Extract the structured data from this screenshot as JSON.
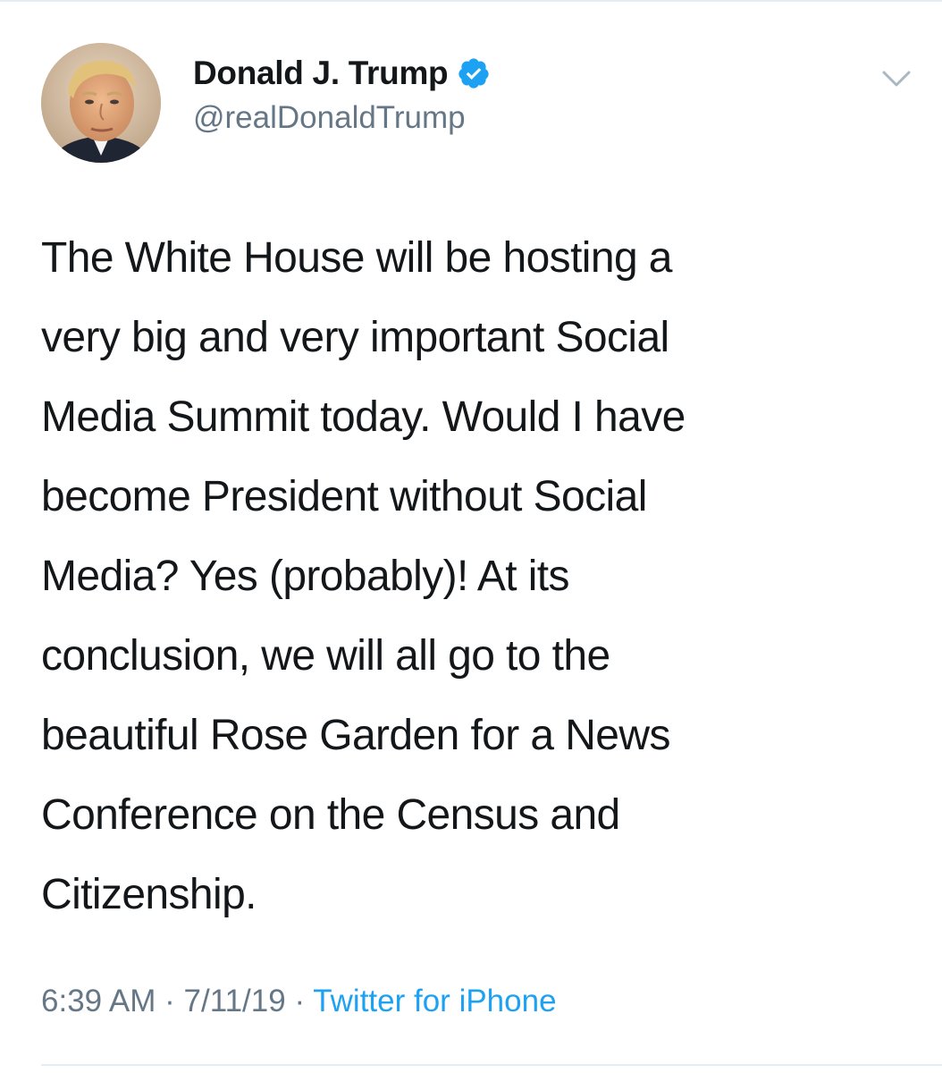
{
  "author": {
    "display_name": "Donald J. Trump",
    "handle": "@realDonaldTrump",
    "verified": true,
    "verified_color": "#1da1f2"
  },
  "tweet": {
    "text": "The White House will be hosting a\nvery big and very important Social\nMedia Summit today. Would I have\nbecome President without Social\nMedia? Yes (probably)! At its\nconclusion, we will all go to the\nbeautiful Rose Garden for a News\nConference on the Census and\nCitizenship."
  },
  "meta": {
    "time": "6:39 AM",
    "separator": " · ",
    "date": "7/11/19",
    "source": "Twitter for iPhone",
    "source_color": "#1da1f2",
    "muted_color": "#657786"
  },
  "icons": {
    "avatar": "profile-photo",
    "verified": "verified-badge-icon",
    "menu": "chevron-down-icon"
  }
}
